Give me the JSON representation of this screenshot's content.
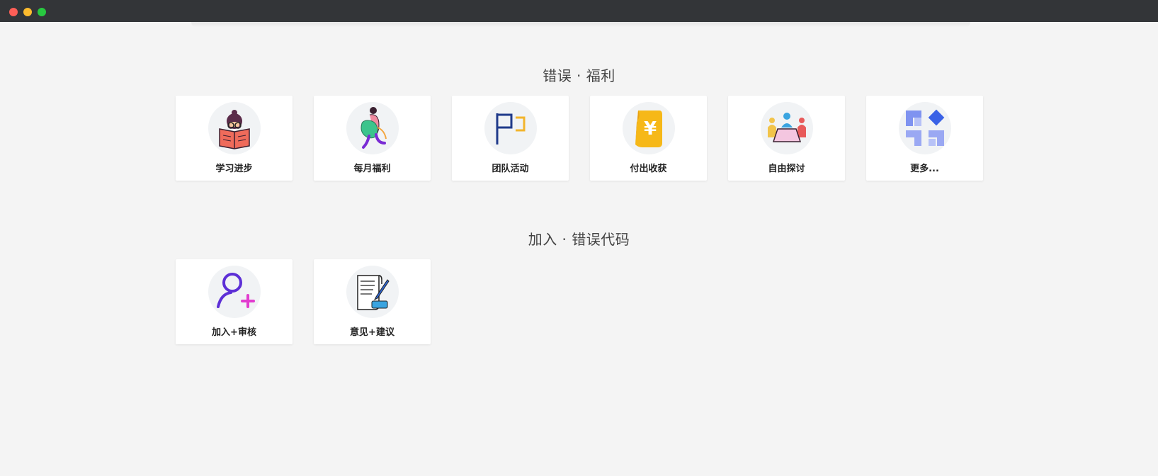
{
  "sections": [
    {
      "title": "错误 · 福利",
      "cards": [
        {
          "label": "学习进步",
          "icon": "reading-book-icon"
        },
        {
          "label": "每月福利",
          "icon": "gift-person-icon"
        },
        {
          "label": "团队活动",
          "icon": "flag-icon"
        },
        {
          "label": "付出收获",
          "icon": "yuan-coin-icon"
        },
        {
          "label": "自由探讨",
          "icon": "meeting-icon"
        },
        {
          "label": "更多...",
          "icon": "more-grid-icon"
        }
      ]
    },
    {
      "title": "加入 · 错误代码",
      "cards": [
        {
          "label": "加入+审核",
          "icon": "add-user-icon"
        },
        {
          "label": "意见+建议",
          "icon": "document-pen-icon"
        }
      ]
    }
  ],
  "colors": {
    "background": "#f4f4f4",
    "titlebar": "#333538",
    "card": "#ffffff",
    "title_text": "#444444",
    "label_text": "#222222"
  }
}
